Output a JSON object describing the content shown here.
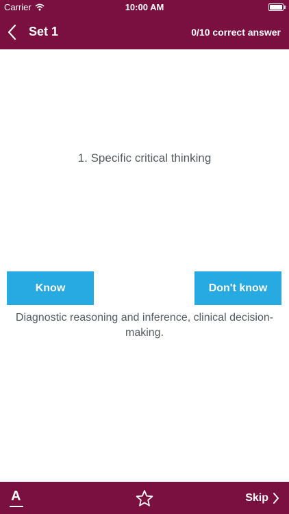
{
  "status_bar": {
    "carrier": "Carrier",
    "time": "10:00 AM"
  },
  "nav": {
    "title": "Set 1",
    "score": "0/10 correct answer"
  },
  "card": {
    "question": "1. Specific critical thinking",
    "know_label": "Know",
    "dont_know_label": "Don't know",
    "answer": "Diagnostic reasoning and inference, clinical decision-making."
  },
  "bottom_bar": {
    "font_letter": "A",
    "skip_label": "Skip"
  },
  "colors": {
    "brand": "#7a1040",
    "button": "#27aae1",
    "text": "#555a5e"
  }
}
